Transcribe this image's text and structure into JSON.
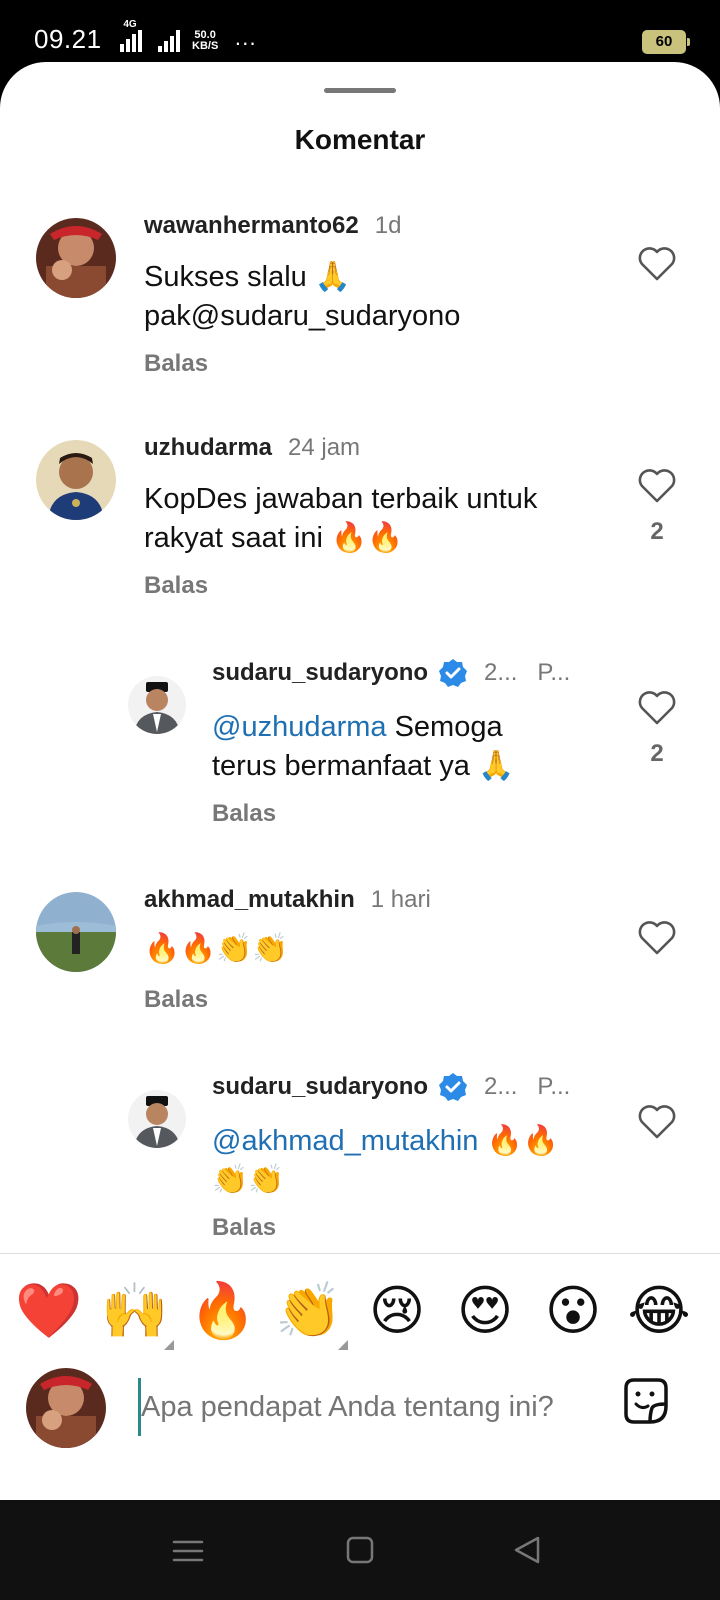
{
  "status_bar": {
    "time": "09.21",
    "network": "4G",
    "speed_value": "50.0",
    "speed_unit": "KB/S",
    "more": "···",
    "battery": "60"
  },
  "sheet": {
    "title": "Komentar"
  },
  "comments": [
    {
      "username": "wawanhermanto62",
      "time": "1d",
      "text_line1": "Sukses slalu 🙏",
      "text_line2": "pak@sudaru_sudaryono",
      "reply_label": "Balas",
      "likes": ""
    },
    {
      "username": "uzhudarma",
      "time": "24 jam",
      "text_line1": "KopDes jawaban terbaik untuk",
      "text_line2": "rakyat saat ini 🔥🔥",
      "reply_label": "Balas",
      "likes": "2"
    },
    {
      "username": "sudaru_sudaryono",
      "time": "2...",
      "extra": "P...",
      "mention": "@uzhudarma",
      "text_line1": " Semoga",
      "text_line2": "terus bermanfaat ya 🙏",
      "reply_label": "Balas",
      "likes": "2"
    },
    {
      "username": "akhmad_mutakhin",
      "time": "1 hari",
      "text_line1": "🔥🔥👏👏",
      "reply_label": "Balas",
      "likes": ""
    },
    {
      "username": "sudaru_sudaryono",
      "time": "2...",
      "extra": "P...",
      "mention": "@akhmad_mutakhin",
      "text_line1": " 🔥🔥",
      "text_line2": "👏👏",
      "reply_label": "Balas",
      "likes": ""
    }
  ],
  "reactions": [
    "❤️",
    "🙌",
    "🔥",
    "👏",
    "😢",
    "😍",
    "😮",
    "😂"
  ],
  "composer": {
    "placeholder": "Apa pendapat Anda tentang ini?"
  },
  "nav": {
    "menu": "menu-icon",
    "home": "square-icon",
    "back": "triangle-back-icon"
  }
}
